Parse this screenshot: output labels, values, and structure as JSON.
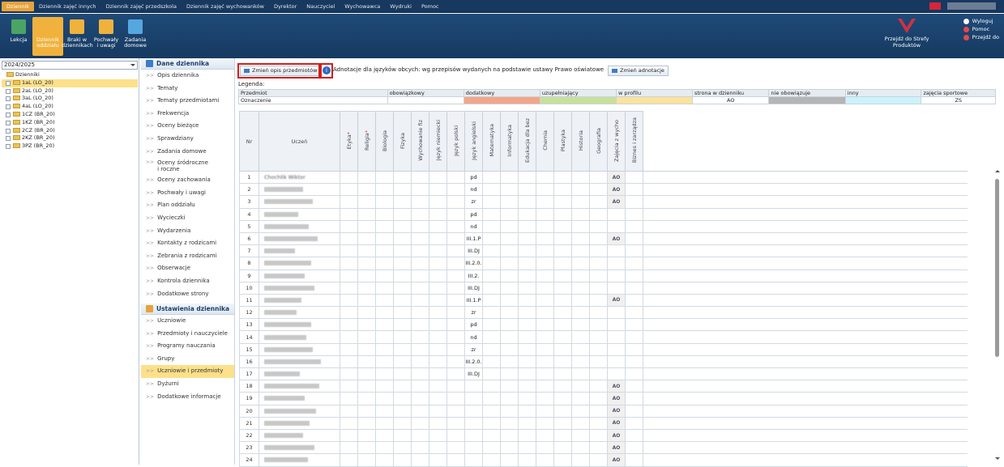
{
  "topnav": {
    "items": [
      "Dziennik",
      "Dziennik zajęć innych",
      "Dziennik zajęć przedszkola",
      "Dziennik zajęć wychowanków",
      "Dyrektor",
      "Nauczyciel",
      "Wychowawca",
      "Wydruki",
      "Pomoc"
    ]
  },
  "ribbon": {
    "items": [
      {
        "label1": "Lekcja",
        "label2": "",
        "color": "#4aa564"
      },
      {
        "label1": "Dziennik",
        "label2": "oddziału",
        "color": "#f0b23c"
      },
      {
        "label1": "Braki w",
        "label2": "dziennikach",
        "color": "#f0b23c"
      },
      {
        "label1": "Pochwały",
        "label2": "i uwagi",
        "color": "#f0b23c"
      },
      {
        "label1": "Zadania",
        "label2": "domowe",
        "color": "#55a7e0"
      }
    ],
    "strefy1": "Przejdź do Strefy",
    "strefy2": "Produktów",
    "links": [
      "Wyloguj",
      "Pomoc",
      "Przejdź do"
    ]
  },
  "left": {
    "year": "2024/2025",
    "root": "Dzienniki",
    "items": [
      "1aL (LO_20)",
      "2aL (LO_20)",
      "3aL (LO_20)",
      "4aL (LO_20)",
      "1CZ (BR_20)",
      "1KZ (BR_20)",
      "2CZ (BR_20)",
      "2KZ (BR_20)",
      "3PZ (BR_20)"
    ]
  },
  "menu": {
    "sec1": "Dane dziennika",
    "items1": [
      "Opis dziennika",
      "Tematy",
      "Tematy przedmiotami",
      "Frekwencja",
      "Oceny bieżące",
      "Sprawdziany",
      "Zadania domowe"
    ],
    "oceny_sr1": "Oceny śródroczne",
    "oceny_sr2": "i roczne",
    "items1b": [
      "Oceny zachowania",
      "Pochwały i uwagi",
      "Plan oddziału",
      "Wycieczki",
      "Wydarzenia",
      "Kontakty z rodzicami",
      "Zebrania z rodzicami",
      "Obserwacje",
      "Kontrola dziennika",
      "Dodatkowe strony"
    ],
    "sec2": "Ustawienia dziennika",
    "items2": [
      "Uczniowie",
      "Przedmioty i nauczyciele",
      "Programy nauczania",
      "Grupy",
      "Uczniowie i przedmioty",
      "Dyżurni",
      "Dodatkowe informacje"
    ]
  },
  "toolbar": {
    "change_desc": "Zmień opis przedmiotów",
    "info": "i",
    "adnot": "Adnotacje dla języków obcych: wg przepisów wydanych na podstawie ustawy Prawo oświatowe",
    "change_adnot": "Zmień adnotacje"
  },
  "legend": {
    "title": "Legenda:",
    "labels": [
      "Przedmiot",
      "obowiązkowy",
      "dodatkowy",
      "uzupełniający",
      "w profilu",
      "strona w dzienniku",
      "nie obowiązuje",
      "inny",
      "zajęcia sportowe"
    ],
    "row2_label": "Oznaczenie",
    "row2": [
      "",
      "",
      "",
      "",
      "AO",
      "",
      "",
      "ZS"
    ],
    "colors": {
      "dodatkowy": "#f3a687",
      "uzupelniajacy": "#c9e09b",
      "profil": "#fbe39c",
      "nieobow": "#b5b5b5",
      "inny": "#cdf3fa"
    }
  },
  "grid": {
    "h_nr": "Nr",
    "h_uczen": "Uczeń",
    "subjects": [
      "Etyka",
      "Religia",
      "Biologia",
      "Fizyka",
      "Wychowanie fiz",
      "Język niemiecki",
      "Język polski",
      "Język angielski",
      "Matematyka",
      "Informatyka",
      "Edukacja dla bez",
      "Chemia",
      "Plastyka",
      "Historia",
      "Geografia",
      "Zajęcia z wycho",
      "Biznes i zarządza"
    ],
    "star": "*",
    "first_name": "Chochlik Wiktor",
    "rows": [
      {
        "nr": "1",
        "ang": "pd",
        "ao": "AO"
      },
      {
        "nr": "2",
        "ang": "nd",
        "ao": "AO"
      },
      {
        "nr": "3",
        "ang": "zr",
        "ao": "AO"
      },
      {
        "nr": "4",
        "ang": "pd",
        "ao": ""
      },
      {
        "nr": "5",
        "ang": "nd",
        "ao": ""
      },
      {
        "nr": "6",
        "ang": "III.1.P",
        "ao": "AO"
      },
      {
        "nr": "7",
        "ang": "III.DJ",
        "ao": ""
      },
      {
        "nr": "8",
        "ang": "III.2.0.",
        "ao": ""
      },
      {
        "nr": "9",
        "ang": "III.2.",
        "ao": ""
      },
      {
        "nr": "10",
        "ang": "III.DJ",
        "ao": ""
      },
      {
        "nr": "11",
        "ang": "III.1.P",
        "ao": "AO"
      },
      {
        "nr": "12",
        "ang": "zr",
        "ao": ""
      },
      {
        "nr": "13",
        "ang": "pd",
        "ao": ""
      },
      {
        "nr": "14",
        "ang": "nd",
        "ao": ""
      },
      {
        "nr": "15",
        "ang": "zr",
        "ao": ""
      },
      {
        "nr": "16",
        "ang": "III.2.0.",
        "ao": ""
      },
      {
        "nr": "17",
        "ang": "III.DJ",
        "ao": ""
      },
      {
        "nr": "18",
        "ang": "",
        "ao": "AO"
      },
      {
        "nr": "19",
        "ang": "",
        "ao": "AO"
      },
      {
        "nr": "20",
        "ang": "",
        "ao": "AO"
      },
      {
        "nr": "21",
        "ang": "",
        "ao": "AO"
      },
      {
        "nr": "22",
        "ang": "",
        "ao": "AO"
      },
      {
        "nr": "23",
        "ang": "",
        "ao": "AO"
      },
      {
        "nr": "24",
        "ang": "",
        "ao": "AO"
      }
    ]
  }
}
